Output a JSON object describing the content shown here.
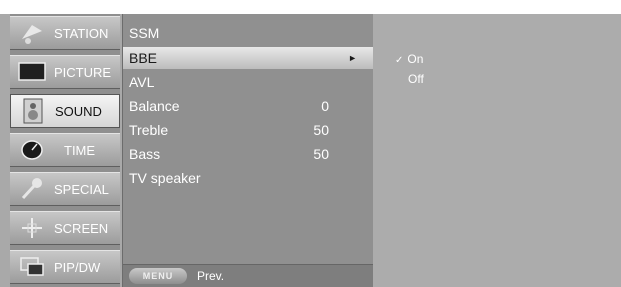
{
  "categories": [
    {
      "label": "STATION",
      "icon": "satellite-dish-icon",
      "selected": false
    },
    {
      "label": "PICTURE",
      "icon": "tv-screen-icon",
      "selected": false
    },
    {
      "label": "SOUND",
      "icon": "speaker-icon",
      "selected": true
    },
    {
      "label": "TIME",
      "icon": "clock-icon",
      "selected": false
    },
    {
      "label": "SPECIAL",
      "icon": "key-icon",
      "selected": false
    },
    {
      "label": "SCREEN",
      "icon": "crosshair-icon",
      "selected": false
    },
    {
      "label": "PIP/DW",
      "icon": "pip-window-icon",
      "selected": false
    }
  ],
  "items": [
    {
      "label": "SSM",
      "value": ""
    },
    {
      "label": "BBE",
      "value": "",
      "selected": true,
      "arrow": "►"
    },
    {
      "label": "AVL",
      "value": ""
    },
    {
      "label": "Balance",
      "value": "0"
    },
    {
      "label": "Treble",
      "value": "50"
    },
    {
      "label": "Bass",
      "value": "50"
    },
    {
      "label": "TV speaker",
      "value": ""
    }
  ],
  "options": [
    {
      "label": "On",
      "checked": true,
      "check_mark": "✓"
    },
    {
      "label": "Off",
      "checked": false,
      "check_mark": ""
    }
  ],
  "footer": {
    "menu_button": "MENU",
    "prev_label": "Prev."
  }
}
